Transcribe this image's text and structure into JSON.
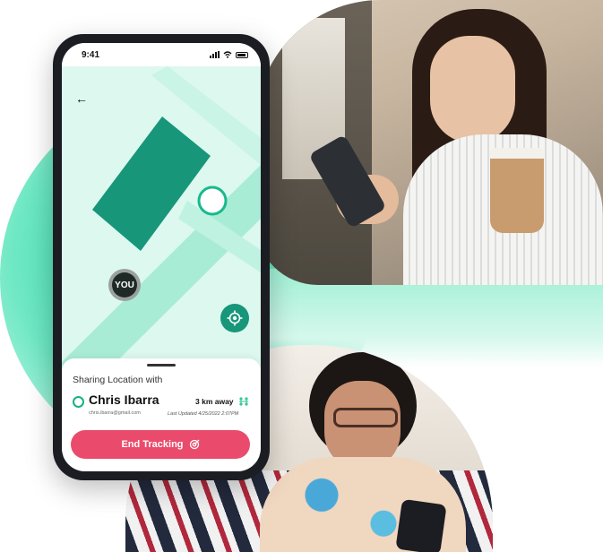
{
  "status_bar": {
    "time": "9:41"
  },
  "map": {
    "you_label": "YOU"
  },
  "sheet": {
    "title": "Sharing Location with",
    "contact_name": "Chris Ibarra",
    "contact_email": "chris.ibarra@gmail.com",
    "distance": "3 km away",
    "last_updated": "Last Updated 4/25/2022 2:07PM",
    "end_button_label": "End Tracking"
  },
  "colors": {
    "accent_green": "#17967a",
    "end_button": "#ea4b6c",
    "map_background": "#dcf8ef",
    "road": "#a9ecd6"
  },
  "icons": [
    "back-arrow-icon",
    "signal-icon",
    "wifi-icon",
    "battery-icon",
    "locate-icon",
    "distance-icon",
    "tracking-icon"
  ]
}
